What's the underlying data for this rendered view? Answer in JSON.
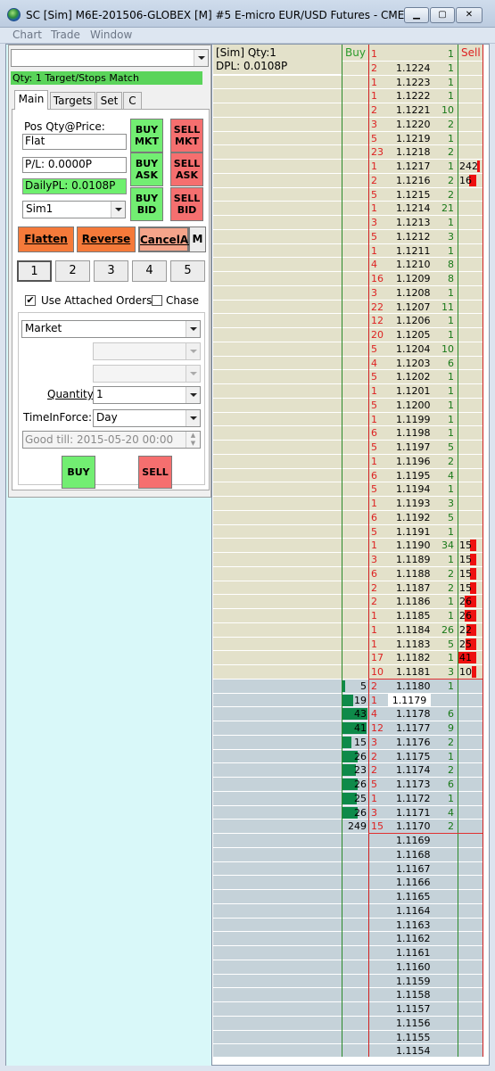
{
  "window": {
    "title": "SC [Sim] M6E-201506-GLOBEX [M]  #5  E-micro EUR/USD Futures - CME",
    "minimize": "▁",
    "maximize": "▢",
    "close": "✕"
  },
  "menu": [
    "Chart",
    "Trade",
    "Window"
  ],
  "left": {
    "account_combo": "",
    "status": "Qty: 1 Target/Stops Match",
    "tabs": [
      "Main",
      "Targets",
      "Set",
      "C"
    ],
    "pos_label": "Pos Qty@Price:",
    "pos_value": "Flat",
    "pl_value": "P/L: 0.0000P",
    "daily_pl": "DailyPL: 0.0108P",
    "account": "Sim1",
    "buy_mkt": [
      "BUY",
      "MKT"
    ],
    "sell_mkt": [
      "SELL",
      "MKT"
    ],
    "buy_ask": [
      "BUY",
      "ASK"
    ],
    "sell_ask": [
      "SELL",
      "ASK"
    ],
    "buy_bid": [
      "BUY",
      "BID"
    ],
    "sell_bid": [
      "SELL",
      "BID"
    ],
    "flatten": "Flatten",
    "reverse": "Reverse",
    "cancel_all": "CancelAll",
    "m_btn": "M",
    "qty_presets": [
      "1",
      "2",
      "3",
      "4",
      "5"
    ],
    "use_attached": "Use Attached Orders",
    "use_attached_checked": true,
    "chase": "Chase",
    "order_type": "Market",
    "quantity_label": "Quantity:",
    "quantity": "1",
    "tif_label": "TimeInForce:",
    "tif": "Day",
    "good_till": "Good till: 2015-05-20 00:00",
    "buy": "BUY",
    "sell": "SELL"
  },
  "ladder": {
    "header": {
      "sim": "[Sim]  Qty:1",
      "dpl": "DPL: 0.0108P",
      "buy": "Buy",
      "sell": "Sell"
    },
    "last_price": "1.1179",
    "colors": {
      "ask_bg": "#e3e1ca",
      "bid_bg": "#c5d2d9",
      "empty_bg": "#c5d2d9",
      "buy_bar": "#0e8a4a",
      "sell_bar": "#ee1010",
      "red_line": "#e03030"
    },
    "rows": [
      {
        "bid": "1",
        "price": "",
        "ask": "1",
        "sell": ""
      },
      {
        "bid": "2",
        "price": "1.1224",
        "ask": "1",
        "sell": ""
      },
      {
        "bid": "1",
        "price": "1.1223",
        "ask": "1",
        "sell": ""
      },
      {
        "bid": "1",
        "price": "1.1222",
        "ask": "1",
        "sell": ""
      },
      {
        "bid": "2",
        "price": "1.1221",
        "ask": "10",
        "sell": ""
      },
      {
        "bid": "3",
        "price": "1.1220",
        "ask": "2",
        "sell": ""
      },
      {
        "bid": "5",
        "price": "1.1219",
        "ask": "1",
        "sell": ""
      },
      {
        "bid": "23",
        "price": "1.1218",
        "ask": "2",
        "sell": ""
      },
      {
        "bid": "1",
        "price": "1.1217",
        "ask": "1",
        "sell": "242"
      },
      {
        "bid": "2",
        "price": "1.1216",
        "ask": "2",
        "sell": "16"
      },
      {
        "bid": "5",
        "price": "1.1215",
        "ask": "2",
        "sell": ""
      },
      {
        "bid": "1",
        "price": "1.1214",
        "ask": "21",
        "sell": ""
      },
      {
        "bid": "3",
        "price": "1.1213",
        "ask": "1",
        "sell": ""
      },
      {
        "bid": "5",
        "price": "1.1212",
        "ask": "3",
        "sell": ""
      },
      {
        "bid": "1",
        "price": "1.1211",
        "ask": "1",
        "sell": ""
      },
      {
        "bid": "4",
        "price": "1.1210",
        "ask": "8",
        "sell": ""
      },
      {
        "bid": "16",
        "price": "1.1209",
        "ask": "8",
        "sell": ""
      },
      {
        "bid": "3",
        "price": "1.1208",
        "ask": "1",
        "sell": ""
      },
      {
        "bid": "22",
        "price": "1.1207",
        "ask": "11",
        "sell": ""
      },
      {
        "bid": "12",
        "price": "1.1206",
        "ask": "1",
        "sell": ""
      },
      {
        "bid": "20",
        "price": "1.1205",
        "ask": "1",
        "sell": ""
      },
      {
        "bid": "5",
        "price": "1.1204",
        "ask": "10",
        "sell": ""
      },
      {
        "bid": "4",
        "price": "1.1203",
        "ask": "6",
        "sell": ""
      },
      {
        "bid": "5",
        "price": "1.1202",
        "ask": "1",
        "sell": ""
      },
      {
        "bid": "1",
        "price": "1.1201",
        "ask": "1",
        "sell": ""
      },
      {
        "bid": "5",
        "price": "1.1200",
        "ask": "1",
        "sell": ""
      },
      {
        "bid": "1",
        "price": "1.1199",
        "ask": "1",
        "sell": ""
      },
      {
        "bid": "6",
        "price": "1.1198",
        "ask": "1",
        "sell": ""
      },
      {
        "bid": "5",
        "price": "1.1197",
        "ask": "5",
        "sell": ""
      },
      {
        "bid": "1",
        "price": "1.1196",
        "ask": "2",
        "sell": ""
      },
      {
        "bid": "6",
        "price": "1.1195",
        "ask": "4",
        "sell": ""
      },
      {
        "bid": "5",
        "price": "1.1194",
        "ask": "1",
        "sell": ""
      },
      {
        "bid": "1",
        "price": "1.1193",
        "ask": "3",
        "sell": ""
      },
      {
        "bid": "6",
        "price": "1.1192",
        "ask": "5",
        "sell": ""
      },
      {
        "bid": "5",
        "price": "1.1191",
        "ask": "1",
        "sell": ""
      },
      {
        "bid": "1",
        "price": "1.1190",
        "ask": "34",
        "sell": "15"
      },
      {
        "bid": "3",
        "price": "1.1189",
        "ask": "1",
        "sell": "15"
      },
      {
        "bid": "6",
        "price": "1.1188",
        "ask": "2",
        "sell": "15"
      },
      {
        "bid": "2",
        "price": "1.1187",
        "ask": "2",
        "sell": "15"
      },
      {
        "bid": "2",
        "price": "1.1186",
        "ask": "1",
        "sell": "26"
      },
      {
        "bid": "1",
        "price": "1.1185",
        "ask": "1",
        "sell": "26"
      },
      {
        "bid": "1",
        "price": "1.1184",
        "ask": "26",
        "sell": "22"
      },
      {
        "bid": "1",
        "price": "1.1183",
        "ask": "5",
        "sell": "25"
      },
      {
        "bid": "17",
        "price": "1.1182",
        "ask": "1",
        "sell": "41"
      },
      {
        "bid": "10",
        "price": "1.1181",
        "ask": "3",
        "sell": "10"
      },
      {
        "buy": "5",
        "bid": "2",
        "price": "1.1180",
        "ask": "1"
      },
      {
        "buy": "19",
        "bid": "1",
        "price": "1.1179",
        "ask": ""
      },
      {
        "buy": "43",
        "bid": "4",
        "price": "1.1178",
        "ask": "6"
      },
      {
        "buy": "41",
        "bid": "12",
        "price": "1.1177",
        "ask": "9"
      },
      {
        "buy": "15",
        "bid": "3",
        "price": "1.1176",
        "ask": "2"
      },
      {
        "buy": "26",
        "bid": "2",
        "price": "1.1175",
        "ask": "1"
      },
      {
        "buy": "23",
        "bid": "2",
        "price": "1.1174",
        "ask": "2"
      },
      {
        "buy": "26",
        "bid": "5",
        "price": "1.1173",
        "ask": "6"
      },
      {
        "buy": "25",
        "bid": "1",
        "price": "1.1172",
        "ask": "1"
      },
      {
        "buy": "26",
        "bid": "3",
        "price": "1.1171",
        "ask": "4"
      },
      {
        "buy": "249",
        "bid": "15",
        "price": "1.1170",
        "ask": "2"
      },
      {
        "price": "1.1169"
      },
      {
        "price": "1.1168"
      },
      {
        "price": "1.1167"
      },
      {
        "price": "1.1166"
      },
      {
        "price": "1.1165"
      },
      {
        "price": "1.1164"
      },
      {
        "price": "1.1163"
      },
      {
        "price": "1.1162"
      },
      {
        "price": "1.1161"
      },
      {
        "price": "1.1160"
      },
      {
        "price": "1.1159"
      },
      {
        "price": "1.1158"
      },
      {
        "price": "1.1157"
      },
      {
        "price": "1.1156"
      },
      {
        "price": "1.1155"
      },
      {
        "price": "1.1154"
      }
    ]
  }
}
